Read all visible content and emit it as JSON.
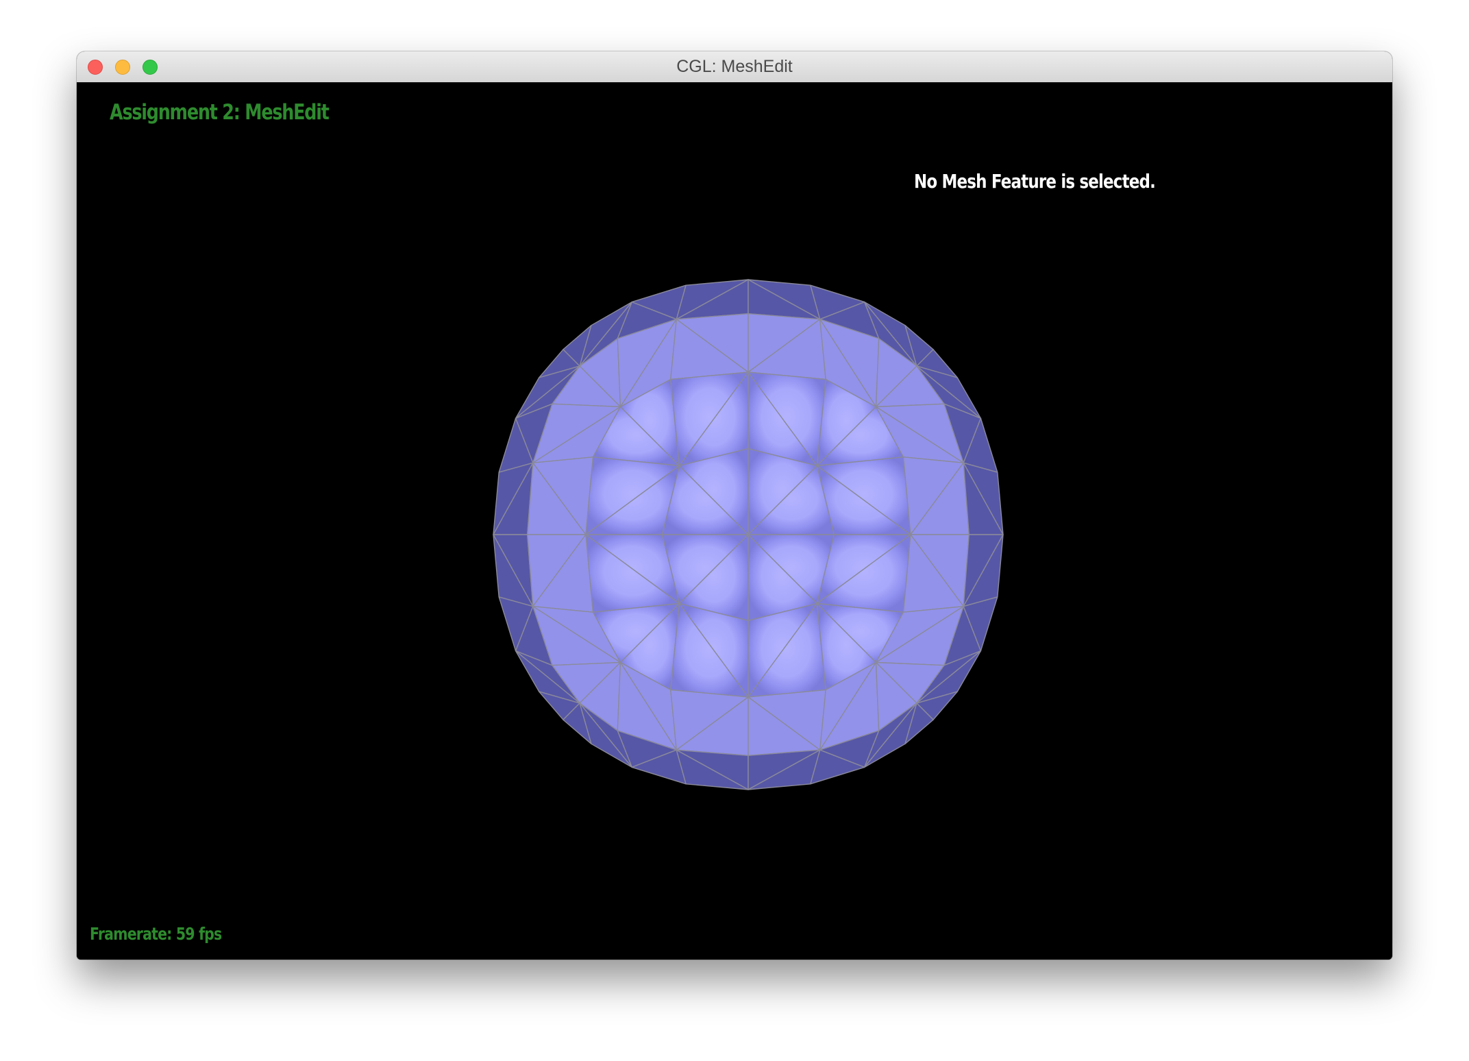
{
  "window": {
    "title": "CGL: MeshEdit"
  },
  "viewport": {
    "app_title": "Assignment 2: MeshEdit",
    "selection_status": "No Mesh Feature is selected.",
    "framerate": "Framerate: 59 fps"
  },
  "colors": {
    "app_text": "#2e8b2e",
    "status_text": "#ffffff",
    "background": "#000000",
    "mesh_light": "#b0b0ff",
    "mesh_mid": "#9a9af8",
    "mesh_dark": "#5c5cb0",
    "wire": "#8a8a9a"
  }
}
